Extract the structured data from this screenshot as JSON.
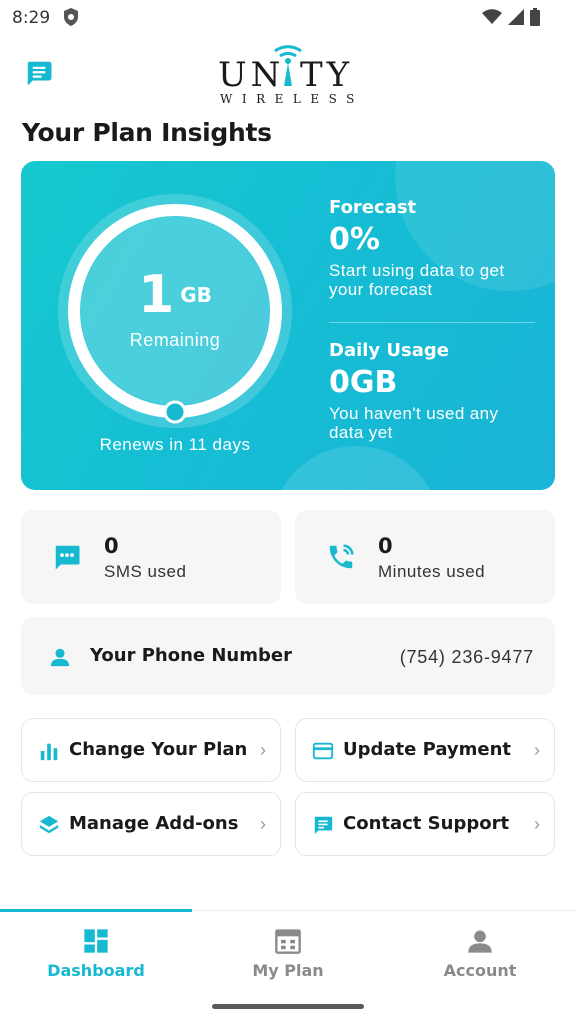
{
  "status_bar": {
    "time": "8:29"
  },
  "header": {
    "logo_top": "UNITY",
    "logo_bottom": "WIRELESS"
  },
  "page_title": "Your Plan Insights",
  "insights": {
    "remaining_amount": "1",
    "remaining_unit": "GB",
    "remaining_label": "Remaining",
    "renews_text": "Renews in 11 days",
    "forecast_title": "Forecast",
    "forecast_value": "0%",
    "forecast_desc_line1": "Start using data to get",
    "forecast_desc_line2": "your forecast",
    "daily_title": "Daily Usage",
    "daily_value": "0GB",
    "daily_desc_line1": "You haven't used any",
    "daily_desc_line2": "data yet",
    "accent_color": "#17c0d2"
  },
  "usage": {
    "sms_count": "0",
    "sms_label": "SMS used",
    "minutes_count": "0",
    "minutes_label": "Minutes used"
  },
  "phone": {
    "label": "Your Phone Number",
    "number": "(754) 236-9477"
  },
  "actions": {
    "change_plan": "Change Your Plan",
    "update_payment": "Update Payment",
    "manage_addons": "Manage Add-ons",
    "contact_support": "Contact Support"
  },
  "nav": {
    "dashboard": "Dashboard",
    "my_plan": "My Plan",
    "account": "Account",
    "active": "Dashboard"
  },
  "icons": {
    "chat": "chat-bubble-icon",
    "sms": "sms-icon",
    "call": "phone-call-icon",
    "person": "person-icon",
    "bar_chart": "bar-chart-icon",
    "card": "credit-card-icon",
    "layers": "layers-icon",
    "support": "support-chat-icon",
    "dashboard": "dashboard-icon",
    "calendar": "calendar-icon",
    "account": "account-icon"
  }
}
